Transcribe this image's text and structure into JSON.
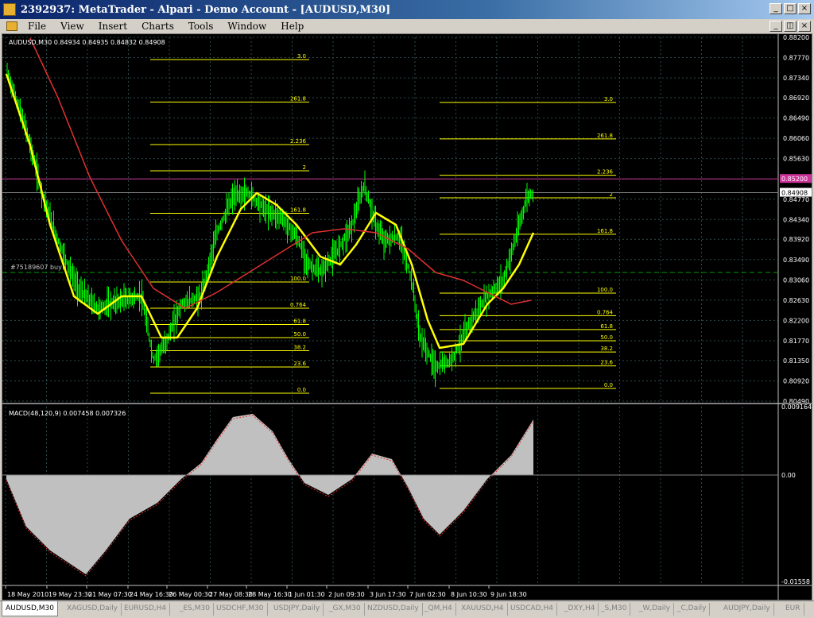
{
  "window": {
    "title": "2392937: MetaTrader - Alpari - Demo Account - [AUDUSD,M30]",
    "controls": [
      "_",
      "□",
      "×"
    ]
  },
  "menu": {
    "items": [
      "File",
      "View",
      "Insert",
      "Charts",
      "Tools",
      "Window",
      "Help"
    ],
    "doc_controls": [
      "_",
      "◫",
      "×"
    ]
  },
  "chart": {
    "header": "AUDUSD,M30  0.84934 0.84935 0.84832 0.84908",
    "order_label": "#75189607 buy",
    "price_axis": [
      "0.88200",
      "0.87770",
      "0.87340",
      "0.86920",
      "0.86490",
      "0.86060",
      "0.85630",
      "0.85200",
      "0.84770",
      "0.84340",
      "0.83920",
      "0.83490",
      "0.83060",
      "0.82630",
      "0.82200",
      "0.81770",
      "0.81350",
      "0.80920",
      "0.80490"
    ],
    "current_price": "0.84908",
    "pink_price": "0.85200",
    "fib_left": [
      {
        "label": "3.0",
        "value": 3.0
      },
      {
        "label": "261.8",
        "value": 2.618
      },
      {
        "label": "2.236",
        "value": 2.236
      },
      {
        "label": "2",
        "value": 2.0
      },
      {
        "label": "161.8",
        "value": 1.618
      },
      {
        "label": "100.0",
        "value": 1.0
      },
      {
        "label": "0.764",
        "value": 0.764
      },
      {
        "label": "61.8",
        "value": 0.618
      },
      {
        "label": "50.0",
        "value": 0.5
      },
      {
        "label": "38.2",
        "value": 0.382
      },
      {
        "label": "23.6",
        "value": 0.236
      },
      {
        "label": "0.0",
        "value": 0.0
      }
    ],
    "fib_right": [
      {
        "label": "3.0",
        "value": 3.0
      },
      {
        "label": "261.8",
        "value": 2.618
      },
      {
        "label": "2.236",
        "value": 2.236
      },
      {
        "label": "2",
        "value": 2.0
      },
      {
        "label": "161.8",
        "value": 1.618
      },
      {
        "label": "100.0",
        "value": 1.0
      },
      {
        "label": "0.764",
        "value": 0.764
      },
      {
        "label": "61.8",
        "value": 0.618
      },
      {
        "label": "50.0",
        "value": 0.5
      },
      {
        "label": "38.2",
        "value": 0.382
      },
      {
        "label": "23.6",
        "value": 0.236
      },
      {
        "label": "0.0",
        "value": 0.0
      }
    ],
    "macd_header": "MACD(48,120,9) 0.007458 0.007326",
    "macd_axis": [
      "0.009164",
      "0.00",
      "-0.01558"
    ],
    "time_axis": [
      "18 May 2010",
      "19 May 23:30",
      "21 May 07:30",
      "24 May 16:30",
      "26 May 00:30",
      "27 May 08:30",
      "28 May 16:30",
      "1 Jun 01:30",
      "2 Jun 09:30",
      "3 Jun 17:30",
      "7 Jun 02:30",
      "8 Jun 10:30",
      "9 Jun 18:30"
    ],
    "colors": {
      "background": "#000000",
      "candles": "#00ff00",
      "ma_fast": "#ffff00",
      "ma_slow": "#e03030",
      "fib": "#ffff00",
      "grid": "#2a4a4a",
      "macd_hist": "#c0c0c0",
      "macd_signal": "#e03030",
      "pink_line": "#cc3399",
      "order_line": "#00a000"
    }
  },
  "tabs": [
    "AUDUSD,M30",
    "XAGUSD,Daily",
    "EURUSD,H4",
    "_ES,M30",
    "USDCHF,M30",
    "USDJPY,Daily",
    "_GX,M30",
    "NZDUSD,Daily",
    "_QM,H4",
    "XAUUSD,H4",
    "USDCAD,H4",
    "_DXY,H4",
    "_S,M30",
    "_W,Daily",
    "_C,Daily",
    "AUDJPY,Daily",
    "EUR"
  ]
}
